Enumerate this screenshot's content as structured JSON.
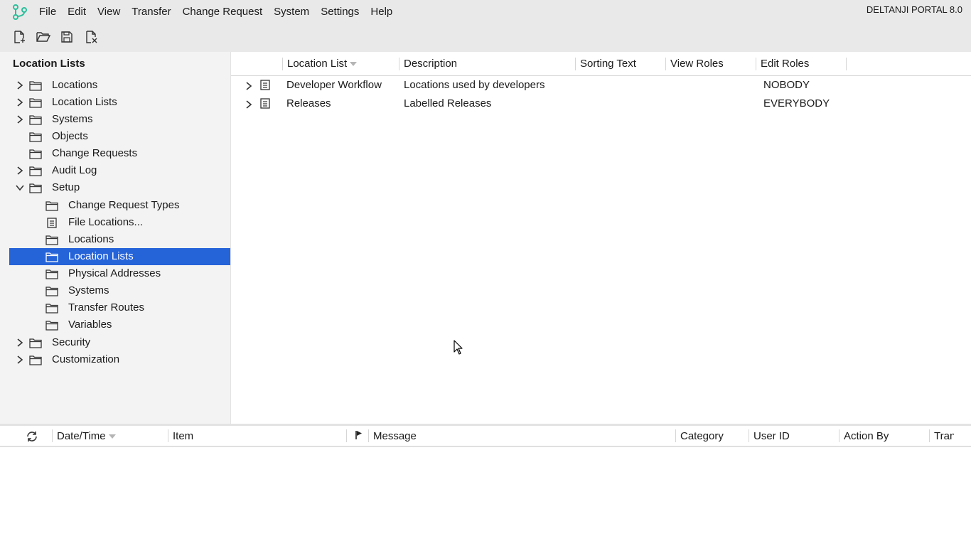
{
  "app": {
    "product": "DELTANJI PORTAL 8.0",
    "logo_icon": "branch-logo-icon",
    "accent_color": "#2563d9",
    "logo_color": "#2bbf9a"
  },
  "menu": {
    "items": [
      "File",
      "Edit",
      "View",
      "Transfer",
      "Change Request",
      "System",
      "Settings",
      "Help"
    ]
  },
  "toolbar": {
    "buttons": [
      "new-document-icon",
      "open-folder-icon",
      "save-icon",
      "close-document-icon"
    ]
  },
  "tree": {
    "title": "Location Lists",
    "items": [
      {
        "label": "Locations",
        "expandable": true,
        "expanded": false,
        "level": 0,
        "icon": "folder-icon"
      },
      {
        "label": "Location Lists",
        "expandable": true,
        "expanded": false,
        "level": 0,
        "icon": "folder-icon"
      },
      {
        "label": "Systems",
        "expandable": true,
        "expanded": false,
        "level": 0,
        "icon": "folder-icon"
      },
      {
        "label": "Objects",
        "expandable": false,
        "expanded": false,
        "level": 0,
        "icon": "folder-icon"
      },
      {
        "label": "Change Requests",
        "expandable": false,
        "expanded": false,
        "level": 0,
        "icon": "folder-icon"
      },
      {
        "label": "Audit Log",
        "expandable": true,
        "expanded": false,
        "level": 0,
        "icon": "folder-icon"
      },
      {
        "label": "Setup",
        "expandable": true,
        "expanded": true,
        "level": 0,
        "icon": "folder-icon"
      },
      {
        "label": "Change Request Types",
        "expandable": false,
        "expanded": false,
        "level": 1,
        "icon": "folder-icon"
      },
      {
        "label": "File Locations...",
        "expandable": false,
        "expanded": false,
        "level": 1,
        "icon": "list-icon"
      },
      {
        "label": "Locations",
        "expandable": false,
        "expanded": false,
        "level": 1,
        "icon": "folder-icon"
      },
      {
        "label": "Location Lists",
        "expandable": false,
        "expanded": false,
        "level": 1,
        "icon": "folder-icon",
        "selected": true
      },
      {
        "label": "Physical Addresses",
        "expandable": false,
        "expanded": false,
        "level": 1,
        "icon": "folder-icon"
      },
      {
        "label": "Systems",
        "expandable": false,
        "expanded": false,
        "level": 1,
        "icon": "folder-icon"
      },
      {
        "label": "Transfer Routes",
        "expandable": false,
        "expanded": false,
        "level": 1,
        "icon": "folder-icon"
      },
      {
        "label": "Variables",
        "expandable": false,
        "expanded": false,
        "level": 1,
        "icon": "folder-icon"
      },
      {
        "label": "Security",
        "expandable": true,
        "expanded": false,
        "level": 0,
        "icon": "folder-icon"
      },
      {
        "label": "Customization",
        "expandable": true,
        "expanded": false,
        "level": 0,
        "icon": "folder-icon"
      }
    ]
  },
  "grid": {
    "columns": [
      "Location List",
      "Description",
      "Sorting Text",
      "View Roles",
      "Edit Roles"
    ],
    "sort_column": "Location List",
    "rows": [
      {
        "location_list": "Developer Workflow",
        "description": "Locations used by developers",
        "sorting_text": "",
        "view_roles": "",
        "edit_roles": "NOBODY"
      },
      {
        "location_list": "Releases",
        "description": "Labelled Releases",
        "sorting_text": "",
        "view_roles": "",
        "edit_roles": "EVERYBODY"
      }
    ]
  },
  "log": {
    "refresh_icon": "refresh-icon",
    "flag_icon": "flag-icon",
    "columns": [
      "Date/Time",
      "Item",
      "Message",
      "Category",
      "User ID",
      "Action By",
      "Tran"
    ],
    "sort_column": "Date/Time"
  }
}
